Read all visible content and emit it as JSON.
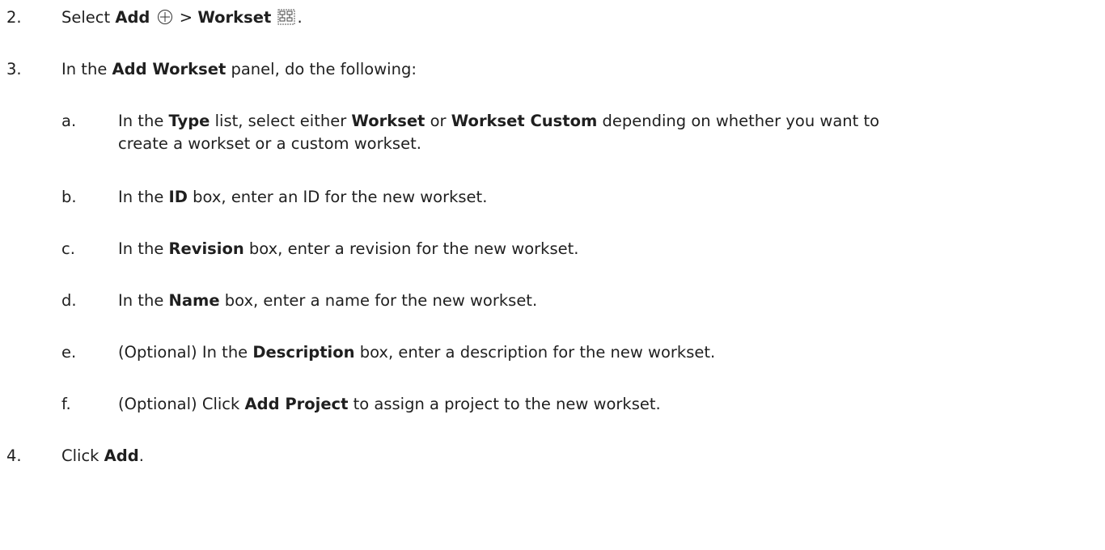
{
  "steps": [
    {
      "num": "2.",
      "parts": [
        "Select ",
        "Add",
        "",
        " > ",
        "Workset",
        "",
        "."
      ],
      "add_icon": "circle-plus-icon",
      "workset_icon": "workset-icon"
    },
    {
      "num": "3.",
      "pre": "In the ",
      "bold": "Add Workset",
      "post": " panel, do the following:",
      "substeps": [
        {
          "letter": "a.",
          "t1": "In the ",
          "b1": "Type",
          "t2": " list, select either ",
          "b2": "Workset",
          "t3": " or ",
          "b3": "Workset Custom",
          "t4": " depending on whether you want to",
          "line2": "create a workset or a custom workset."
        },
        {
          "letter": "b.",
          "t1": "In the ",
          "b1": "ID",
          "t2": " box, enter an ID for the new workset."
        },
        {
          "letter": "c.",
          "t1": "In the ",
          "b1": "Revision",
          "t2": " box, enter a revision for the new workset."
        },
        {
          "letter": "d.",
          "t1": "In the ",
          "b1": "Name",
          "t2": " box, enter a name for the new workset."
        },
        {
          "letter": "e.",
          "t1": "(Optional) In the ",
          "b1": "Description",
          "t2": " box, enter a description for the new workset."
        },
        {
          "letter": "f.",
          "t1": "(Optional) Click ",
          "b1": "Add Project",
          "t2": " to assign a project to the new workset."
        }
      ]
    },
    {
      "num": "4.",
      "pre": "Click ",
      "bold": "Add",
      "post": "."
    }
  ]
}
